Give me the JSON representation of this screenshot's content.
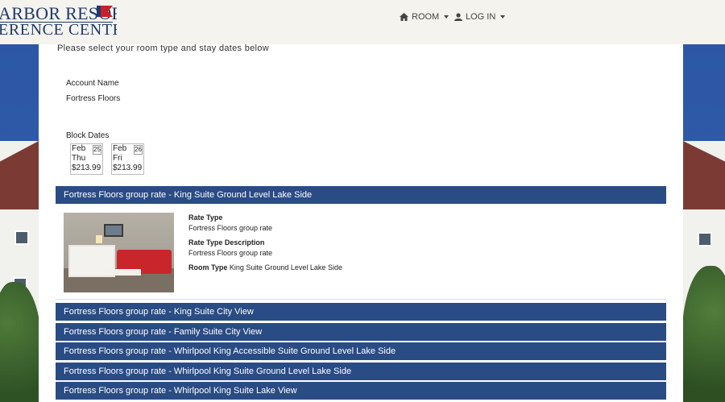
{
  "header": {
    "logo_line1": "ARBOR RESORT",
    "logo_line2": "ERENCE CENTER",
    "nav": [
      {
        "label": "ROOM",
        "icon": "home-icon"
      },
      {
        "label": "LOG IN",
        "icon": "user-icon"
      }
    ]
  },
  "main": {
    "intro": "Please select your room type and stay dates below",
    "account_label": "Account Name",
    "account_value": "Fortress Floors",
    "block_dates_label": "Block Dates",
    "dates": [
      {
        "month": "Feb",
        "day": "25",
        "weekday": "Thu",
        "price": "$213.99"
      },
      {
        "month": "Feb",
        "day": "26",
        "weekday": "Fri",
        "price": "$213.99"
      }
    ],
    "selected_rate": {
      "title": "Fortress Floors group rate - King Suite Ground Level Lake Side",
      "rate_type_label": "Rate Type",
      "rate_type": "Fortress Floors group rate",
      "rate_desc_label": "Rate Type Description",
      "rate_desc": "Fortress Floors group rate",
      "room_type_label": "Room Type",
      "room_type": "King Suite Ground Level Lake Side"
    },
    "rates": [
      "Fortress Floors group rate - King Suite City View",
      "Fortress Floors group rate - Family Suite City View",
      "Fortress Floors group rate - Whirlpool King Accessible Suite Ground Level Lake Side",
      "Fortress Floors group rate - Whirlpool King Suite Ground Level Lake Side",
      "Fortress Floors group rate - Whirlpool King Suite Lake View"
    ]
  },
  "colors": {
    "rate_bar": "#2a4c85",
    "brand": "#1f3a6b",
    "header_bg": "#f4f3ee"
  }
}
